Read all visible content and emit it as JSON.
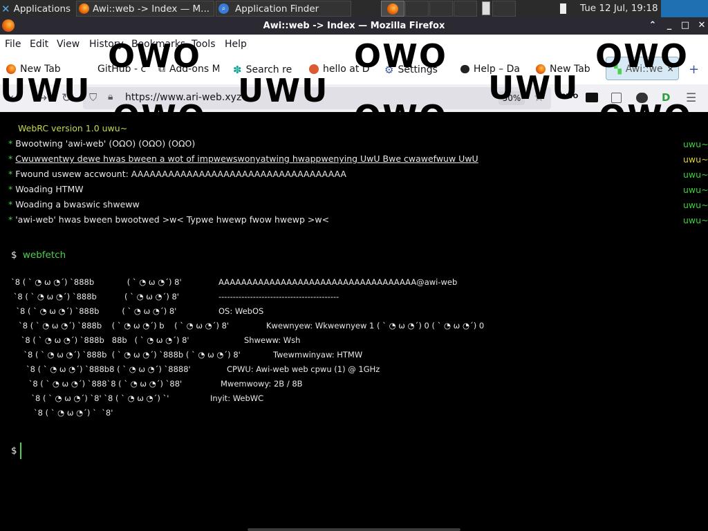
{
  "taskbar": {
    "apps_label": "Applications",
    "window1": "Awi::web -> Index — M...",
    "window2": "Application Finder",
    "clock": "Tue 12 Jul, 19:18"
  },
  "window": {
    "title": "Awi::web -> Index — Mozilla Firefox"
  },
  "menu": [
    "File",
    "Edit",
    "View",
    "History",
    "Bookmarks",
    "Tools",
    "Help"
  ],
  "bookmarks": [
    {
      "label": "New Tab",
      "color": "#e66000"
    },
    {
      "label": "GitHub - c",
      "color": "#ffffff"
    },
    {
      "label": "Add-ons M",
      "color": "#ffffff"
    },
    {
      "label": "Search re",
      "color": "#1aa39b"
    },
    {
      "label": "hello at D",
      "color": "#de5833"
    },
    {
      "label": "Settings",
      "color": "#ffffff"
    },
    {
      "label": "Help – Da",
      "color": "#222222"
    },
    {
      "label": "New Tab",
      "color": "#e66000"
    },
    {
      "label": "Awi::we",
      "color": "#4fcf4f"
    }
  ],
  "navbar": {
    "url": "https://www.ari-web.xyz",
    "zoom": "50%",
    "ext_label": "OWO"
  },
  "overlays": {
    "owo": "OWO",
    "uwu": "UWU"
  },
  "terminal": {
    "version": "WebRC version 1.0 uwu~",
    "log": [
      "Bwootwing 'awi-web' (OΩO) (OΩO) (OΩO)",
      "Cwuwwentwy dewe hwas bween a wot of impwewswonyatwing hwappwenying UwU Bwe cwawefwuw UwU",
      "Fwound uswew accwount: AAAAAAAAAAAAAAAAAAAAAAAAAAAAAAAAAAA",
      "Woading HTMW",
      "Woading a bwaswic shweww",
      "'awi-web' hwas bween bwootwed >w< Typwe hwewp fwow hwewp >w<"
    ],
    "log_tag": "uwu~",
    "prompt": "$",
    "command": "webfetch",
    "ascii": [
      "`8 ( ˋ ◔ ω ◔ˊ) `888b             ( ˋ ◔ ω ◔ˊ) 8'",
      " `8 ( ˋ ◔ ω ◔ˊ) `888b           ( ˋ ◔ ω ◔ˊ) 8'",
      "  `8 ( ˋ ◔ ω ◔ˊ) `888b         ( ˋ ◔ ω ◔ˊ) 8'",
      "   `8 ( ˋ ◔ ω ◔ˊ) `888b    ( ˋ ◔ ω ◔ˊ) b    ( ˋ ◔ ω ◔ˊ) 8'",
      "    `8 ( ˋ ◔ ω ◔ˊ) `888b   88b   ( ˋ ◔ ω ◔ˊ) 8'",
      "     `8 ( ˋ ◔ ω ◔ˊ) `888b  ( ˋ ◔ ω ◔ˊ) `888b ( ˋ ◔ ω ◔ˊ) 8'",
      "      `8 ( ˋ ◔ ω ◔ˊ) `888b8 ( ˋ ◔ ω ◔ˊ) `8888'",
      "       `8 ( ˋ ◔ ω ◔ˊ) `888`8 ( ˋ ◔ ω ◔ˊ) `88'",
      "        `8 ( ˋ ◔ ω ◔ˊ) `8' `8 ( ˋ ◔ ω ◔ˊ) `'",
      "         `8 ( ˋ ◔ ω ◔ˊ) `  `8'"
    ],
    "info": [
      "AAAAAAAAAAAAAAAAAAAAAAAAAAAAAAAAAAA@awi-web",
      "------------------------------------------",
      "OS: WebOS",
      "Kwewnyew: Wkwewnyew 1 ( ˋ ◔ ω ◔ˊ) 0 ( ˋ ◔ ω ◔ˊ) 0",
      "Shweww: Wsh",
      "Twewmwinyaw: HTMW",
      "CPWU: Awi-web web cpwu (1) @ 1GHz",
      "Mwemwowy: 2B / 8B",
      "Inyit: WebWC"
    ]
  },
  "colors": {
    "terminal_bg": "#000000",
    "prompt_green": "#4fcf4f",
    "version_yellowgreen": "#c8d94a"
  }
}
